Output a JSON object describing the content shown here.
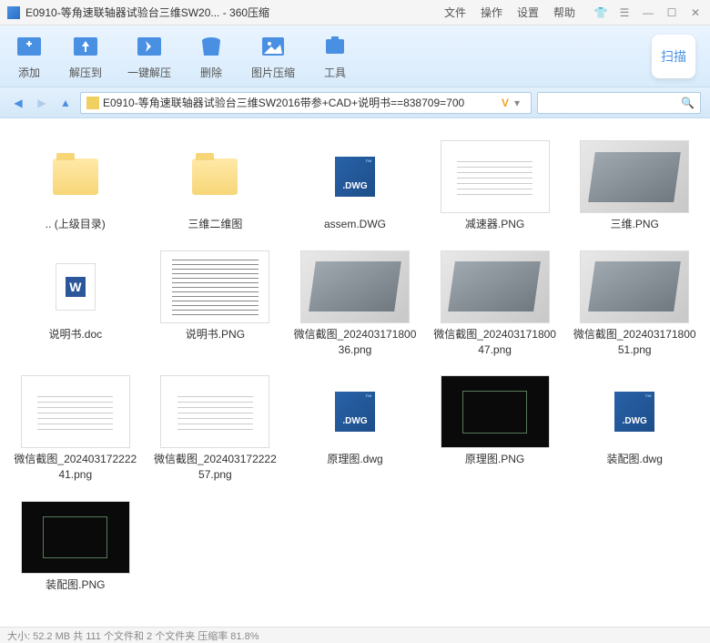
{
  "titlebar": {
    "title": "E0910-等角速联轴器试验台三维SW20... - 360压缩",
    "menu": [
      "文件",
      "操作",
      "设置",
      "帮助"
    ]
  },
  "toolbar": {
    "buttons": [
      {
        "label": "添加",
        "icon": "add"
      },
      {
        "label": "解压到",
        "icon": "extract"
      },
      {
        "label": "一键解压",
        "icon": "oneclick"
      },
      {
        "label": "删除",
        "icon": "delete"
      },
      {
        "label": "图片压缩",
        "icon": "image"
      },
      {
        "label": "工具",
        "icon": "tools"
      }
    ],
    "scan": "扫描"
  },
  "navbar": {
    "path": "E0910-等角速联轴器试验台三维SW2016带参+CAD+说明书==838709=700"
  },
  "files": [
    {
      "name": ".. (上级目录)",
      "type": "folder"
    },
    {
      "name": "三维二维图",
      "type": "folder"
    },
    {
      "name": "assem.DWG",
      "type": "dwg"
    },
    {
      "name": "减速器.PNG",
      "type": "png-white"
    },
    {
      "name": "三维.PNG",
      "type": "png-3d"
    },
    {
      "name": "说明书.doc",
      "type": "doc"
    },
    {
      "name": "说明书.PNG",
      "type": "png-text"
    },
    {
      "name": "微信截图_20240317180036.png",
      "type": "png-3d"
    },
    {
      "name": "微信截图_20240317180047.png",
      "type": "png-3d"
    },
    {
      "name": "微信截图_20240317180051.png",
      "type": "png-3d"
    },
    {
      "name": "微信截图_20240317222241.png",
      "type": "png-white"
    },
    {
      "name": "微信截图_20240317222257.png",
      "type": "png-white"
    },
    {
      "name": "原理图.dwg",
      "type": "dwg"
    },
    {
      "name": "原理图.PNG",
      "type": "png-cad"
    },
    {
      "name": "装配图.dwg",
      "type": "dwg"
    },
    {
      "name": "装配图.PNG",
      "type": "png-cad"
    }
  ],
  "statusbar": {
    "text": "大小: 52.2 MB 共 111 个文件和 2 个文件夹 压缩率 81.8%"
  }
}
